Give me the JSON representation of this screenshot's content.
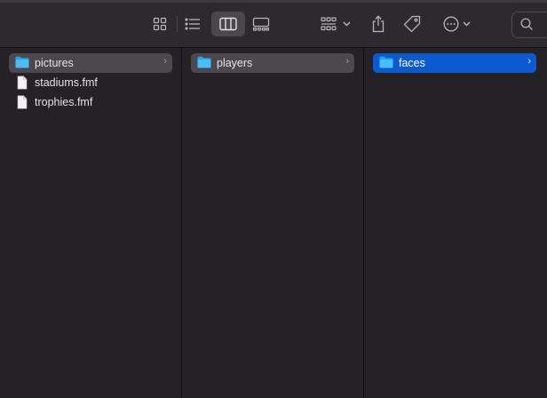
{
  "toolbar": {
    "view_buttons": [
      {
        "icon": "icon-view-grid-icon",
        "active": false
      },
      {
        "icon": "list-view-icon",
        "active": false
      },
      {
        "icon": "column-view-icon",
        "active": true
      },
      {
        "icon": "gallery-view-icon",
        "active": false
      }
    ],
    "group_icon": "group-by-icon",
    "share_icon": "share-icon",
    "tag_icon": "tag-icon",
    "more_icon": "more-actions-icon",
    "search_icon": "search-icon"
  },
  "columns": [
    {
      "items": [
        {
          "label": "pictures",
          "kind": "folder",
          "state": "selected-inactive",
          "has_children": true
        },
        {
          "label": "stadiums.fmf",
          "kind": "file",
          "state": "normal",
          "has_children": false
        },
        {
          "label": "trophies.fmf",
          "kind": "file",
          "state": "normal",
          "has_children": false
        }
      ]
    },
    {
      "items": [
        {
          "label": "players",
          "kind": "folder",
          "state": "selected-inactive",
          "has_children": true
        }
      ]
    },
    {
      "items": [
        {
          "label": "faces",
          "kind": "folder",
          "state": "selected-active",
          "has_children": true
        }
      ]
    }
  ],
  "colors": {
    "accent": "#0b5ad1",
    "folder": "#1ea7f0",
    "background": "#252226"
  }
}
